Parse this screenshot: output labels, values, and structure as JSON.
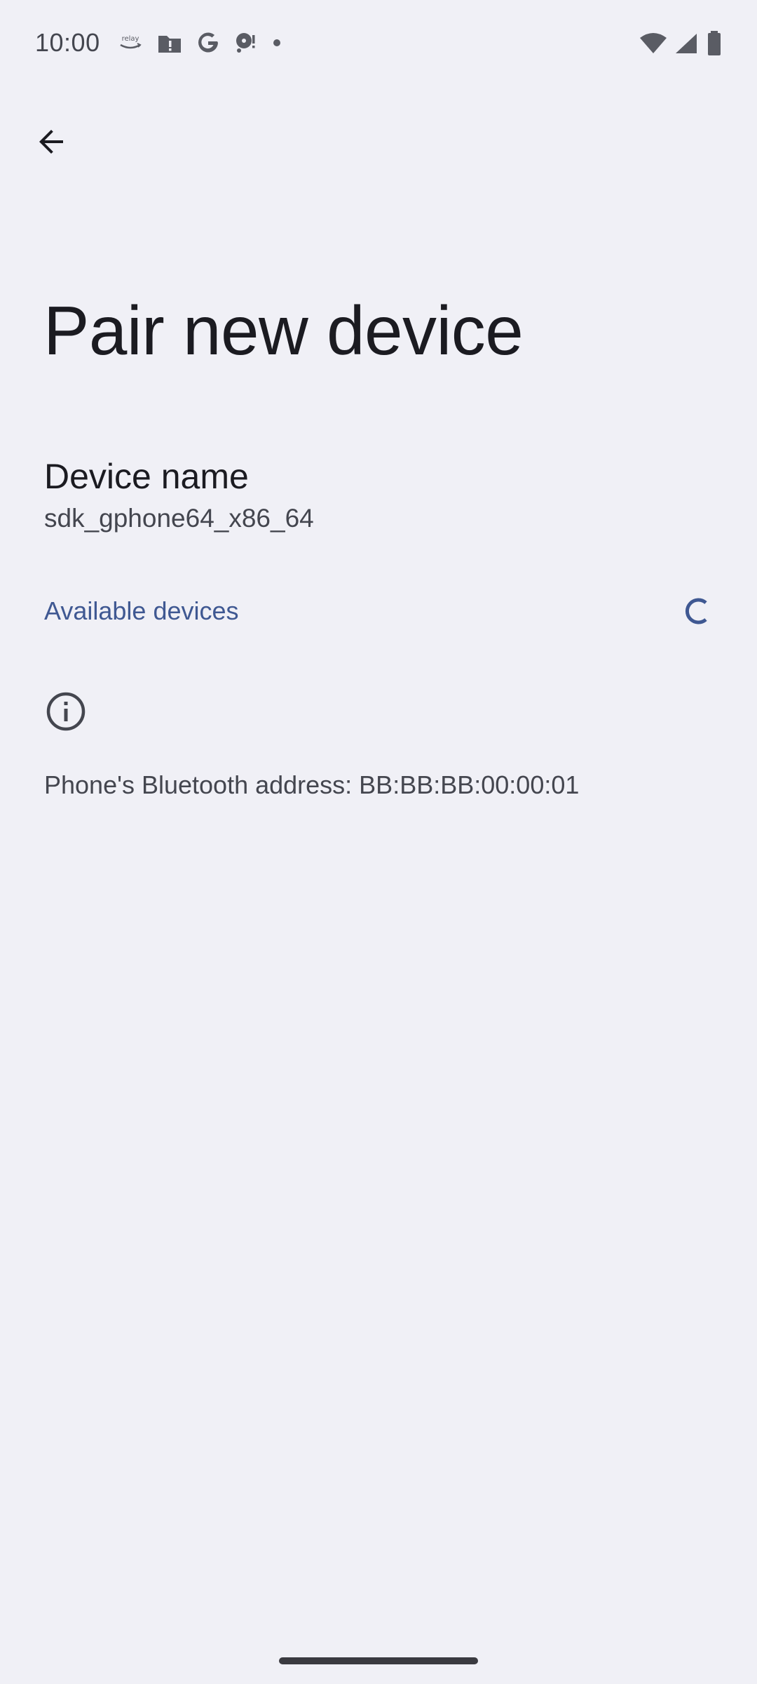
{
  "status_bar": {
    "time": "10:00",
    "left_icons": [
      "relay-icon",
      "folder-alert-icon",
      "google-icon",
      "assistant-icon",
      "dot-icon"
    ],
    "relay_label": "relay",
    "right_icons": [
      "wifi-icon",
      "cell-signal-icon",
      "battery-icon"
    ]
  },
  "toolbar": {
    "back_icon": "arrow-back-icon"
  },
  "page": {
    "title": "Pair new device"
  },
  "device_name": {
    "title": "Device name",
    "summary": "sdk_gphone64_x86_64"
  },
  "available_devices": {
    "title": "Available devices",
    "scanning_icon": "progress-spinner-icon"
  },
  "footer_info": {
    "icon": "info-icon",
    "text": "Phone's Bluetooth address: BB:BB:BB:00:00:01"
  },
  "colors": {
    "background": "#f0f0f6",
    "accent": "#3f5892",
    "text_primary": "#1b1b21",
    "text_secondary": "#44464f"
  }
}
